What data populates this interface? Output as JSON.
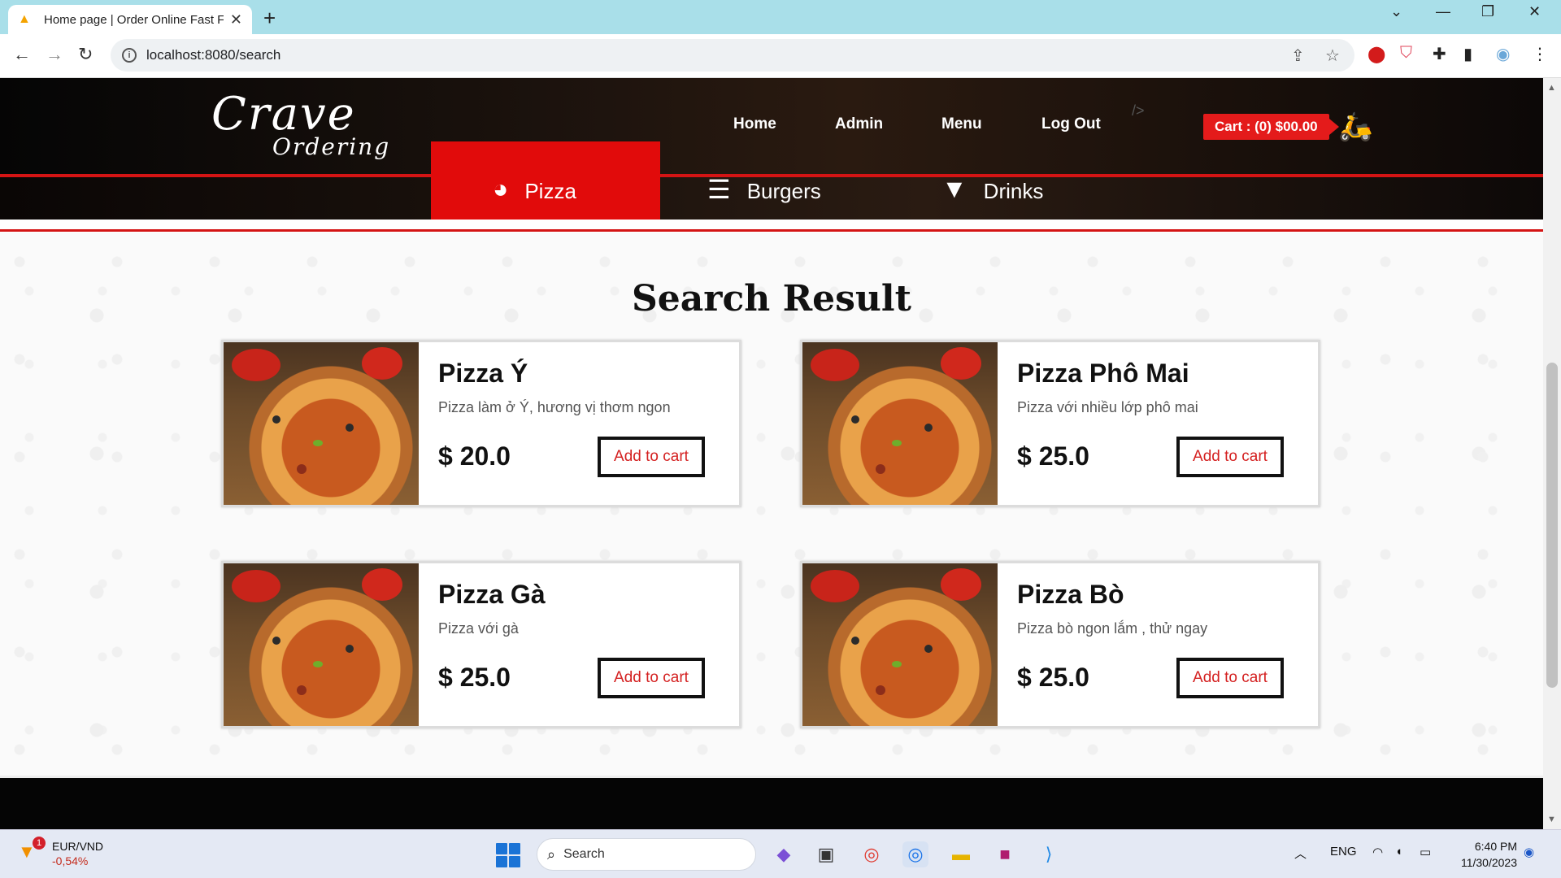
{
  "browser": {
    "tab_title": "Home page | Order Online Fast F",
    "url": "localhost:8080/search",
    "new_tab_glyph": "+",
    "tab_close_glyph": "✕",
    "window_controls": [
      "⌄",
      "—",
      "❐",
      "✕"
    ]
  },
  "site": {
    "logo_line1": "Crave",
    "logo_line2": "Ordering",
    "nav": [
      "Home",
      "Admin",
      "Menu",
      "Log Out"
    ],
    "ghost_text": "/>",
    "cart_label": "Cart : (0) $00.00",
    "categories": [
      {
        "label": "Pizza",
        "icon": "pizza-icon",
        "active": true
      },
      {
        "label": "Burgers",
        "icon": "burger-icon",
        "active": false
      },
      {
        "label": "Drinks",
        "icon": "drink-icon",
        "active": false
      }
    ]
  },
  "search": {
    "title": "Search Result",
    "results": [
      {
        "name": "Pizza Ý",
        "desc": "Pizza làm ở Ý, hương vị thơm ngon",
        "price": "$ 20.0",
        "button": "Add to cart"
      },
      {
        "name": "Pizza Phô Mai",
        "desc": "Pizza với nhiều lớp phô mai",
        "price": "$ 25.0",
        "button": "Add to cart"
      },
      {
        "name": "Pizza Gà",
        "desc": "Pizza với gà",
        "price": "$ 25.0",
        "button": "Add to cart"
      },
      {
        "name": "Pizza Bò",
        "desc": "Pizza bò ngon lắm , thử ngay",
        "price": "$ 25.0",
        "button": "Add to cart"
      }
    ]
  },
  "taskbar": {
    "weather_badge": "1",
    "weather_line1": "EUR/VND",
    "weather_line2": "-0,54%",
    "search_label": "Search",
    "lang": "ENG",
    "time": "6:40 PM",
    "date": "11/30/2023"
  },
  "colors": {
    "accent_red": "#e10b0b",
    "cart_red": "#e41b1b",
    "button_text_red": "#d42020",
    "tabbar": "#a9dfe9"
  }
}
